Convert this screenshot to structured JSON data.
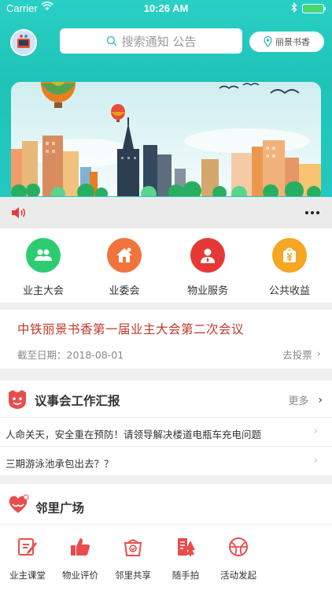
{
  "status_bar": {
    "carrier": "Carrier",
    "time": "10:26 AM"
  },
  "header": {
    "search_placeholder": "搜索通知 公告",
    "location": "丽景书香"
  },
  "features": [
    {
      "label": "业主大会",
      "color": "#2ecc71",
      "icon": "people-icon"
    },
    {
      "label": "业委会",
      "color": "#f0743c",
      "icon": "home-icon"
    },
    {
      "label": "物业服务",
      "color": "#e53935",
      "icon": "user-icon"
    },
    {
      "label": "公共收益",
      "color": "#f5a623",
      "icon": "money-icon"
    }
  ],
  "meeting": {
    "title": "中铁丽景书香第一届业主大会第二次会议",
    "deadline": "截至日期：2018-08-01",
    "action": "去投票"
  },
  "council": {
    "title": "议事会工作汇报",
    "more": "更多",
    "items": [
      "人命关天，安全重在预防！请领导解决楼道电瓶车充电问题",
      "三期游泳池承包出去？？"
    ]
  },
  "neighbors": {
    "title": "邻里广场"
  },
  "tabs": [
    {
      "label": "业主课堂",
      "icon": "edit-icon"
    },
    {
      "label": "物业评价",
      "icon": "thumbs-up-icon"
    },
    {
      "label": "邻里共享",
      "icon": "basket-icon"
    },
    {
      "label": "随手拍",
      "icon": "camera-tree-icon"
    },
    {
      "label": "活动发起",
      "icon": "ball-icon"
    }
  ],
  "colors": {
    "accent": "#1fc3b8",
    "red": "#e53935",
    "title_red": "#c0392b"
  }
}
